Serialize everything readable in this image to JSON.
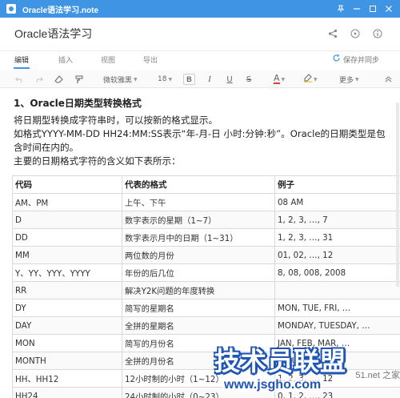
{
  "window": {
    "title": "Oracle语法学习.note"
  },
  "header": {
    "doc_title": "Oracle语法学习"
  },
  "tabs": [
    {
      "label": "编辑",
      "active": true
    },
    {
      "label": "插入",
      "active": false
    },
    {
      "label": "视图",
      "active": false
    },
    {
      "label": "导出",
      "active": false
    }
  ],
  "sync": {
    "label": "保存并同步"
  },
  "toolbar": {
    "font_name": "微软雅黑",
    "font_size": "18",
    "bold": "B",
    "italic": "I",
    "underline": "U",
    "strike": "S",
    "font_color": "A",
    "more": "更多"
  },
  "colors": {
    "accent": "#3f95e3",
    "watermark": "#1f56b6",
    "font_color_underline": "#e23a3a",
    "highlight": "#f5d63d"
  },
  "content": {
    "heading": "1、Oracle日期类型转换格式",
    "paragraphs": [
      "将日期型转换成字符串时，可以按新的格式显示。",
      "如格式YYYY-MM-DD HH24:MM:SS表示“年-月-日 小时:分钟:秒”。Oracle的日期类型是包含时间在内的。",
      "主要的日期格式字符的含义如下表所示："
    ]
  },
  "table": {
    "headers": [
      "代码",
      "代表的格式",
      "例子"
    ],
    "rows": [
      [
        "AM、PM",
        "上午、下午",
        "08 AM"
      ],
      [
        "D",
        "数字表示的星期（1~7）",
        "1, 2, 3, …, 7"
      ],
      [
        "DD",
        "数字表示月中的日期（1~31）",
        "1, 2, 3, …, 31"
      ],
      [
        "MM",
        "两位数的月份",
        "01, 02, …, 12"
      ],
      [
        "Y、YY、YYY、YYYY",
        "年份的后几位",
        "8, 08, 008, 2008"
      ],
      [
        "RR",
        "解决Y2K问题的年度转换",
        ""
      ],
      [
        "DY",
        "简写的星期名",
        "MON, TUE, FRI, …"
      ],
      [
        "DAY",
        "全拼的星期名",
        "MONDAY, TUESDAY, …"
      ],
      [
        "MON",
        "简写的月份名",
        "JAN, FEB, MAR, …"
      ],
      [
        "MONTH",
        "全拼的月份名",
        "JANUARY, …"
      ],
      [
        "HH、HH12",
        "12小时制的小时（1~12）",
        "1, 2, 3, …, 12"
      ],
      [
        "HH24",
        "24小时制的小时（0~23）",
        "0, 1, 2, …, 23"
      ]
    ]
  },
  "watermark": {
    "main": "技术员联盟",
    "url": "www.jsgho.com",
    "side": "51.net 之家"
  }
}
